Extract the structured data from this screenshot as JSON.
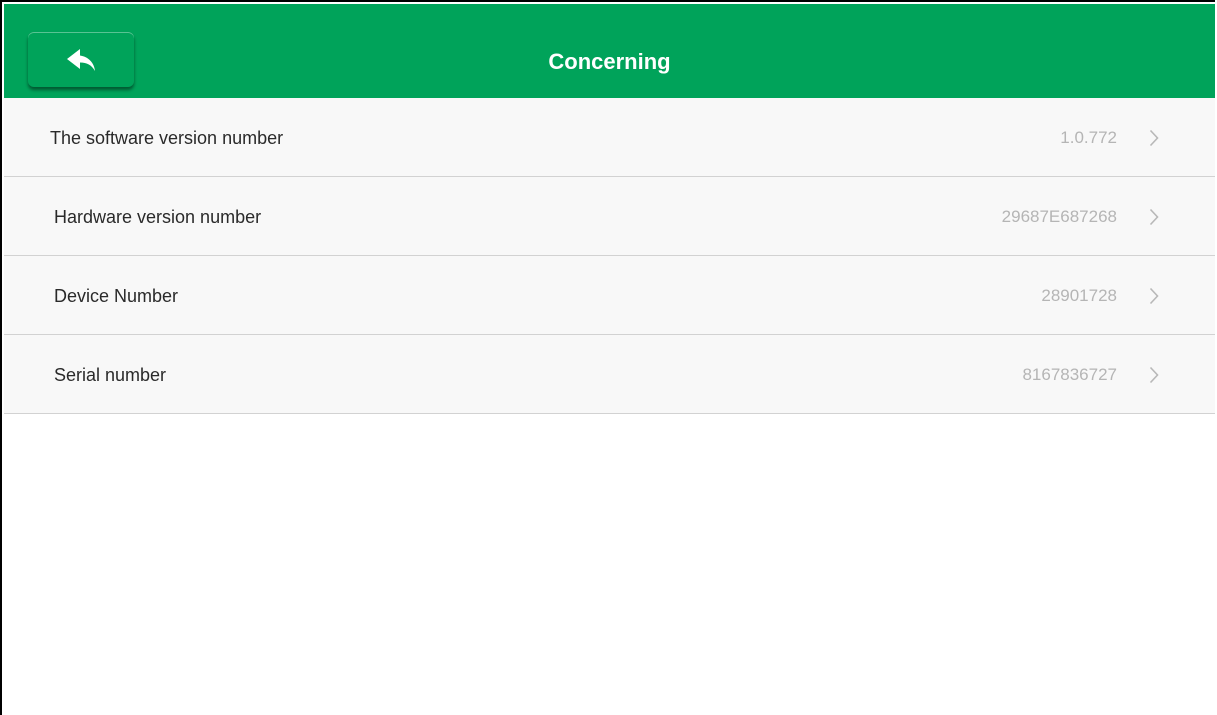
{
  "header": {
    "title": "Concerning",
    "back_icon": "back-arrow-icon",
    "background_color": "#00a35a"
  },
  "items": [
    {
      "label": "The software version number",
      "value": "1.0.772",
      "icon": "chevron-right-icon"
    },
    {
      "label": "Hardware version number",
      "value": "29687E687268",
      "icon": "chevron-right-icon"
    },
    {
      "label": "Device Number",
      "value": "28901728",
      "icon": "chevron-right-icon"
    },
    {
      "label": "Serial number",
      "value": "8167836727",
      "icon": "chevron-right-icon"
    }
  ]
}
